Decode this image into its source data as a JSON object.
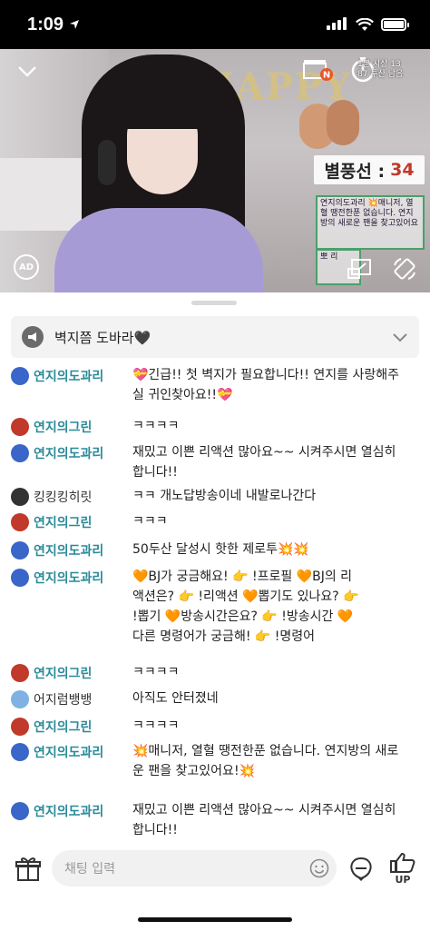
{
  "status": {
    "time": "1:09"
  },
  "video": {
    "balloon_label": "별풍선 :",
    "balloon_count": "34",
    "overlay_chat_text": "연지의도과리 💥매니저, 열혈 땡전한푼 없습니다. 연지방의 새로운 팬을 찾고있어요",
    "overlay_chat2_text": "뽀 리",
    "settings_line1": "1분 시상 13",
    "settings_line2": "87 투산 남음",
    "ad_label": "AD",
    "rec_badge": "N"
  },
  "notice": {
    "text": "벽지쯤 도바라🖤"
  },
  "messages": [
    {
      "nick": "연지의도과리",
      "avatar": "#3a65c9",
      "text": "💝긴급!! 첫 벽지가 필요합니다!! 연지를 사랑해주실 귀인찾아요!!💝",
      "bold": true
    },
    {
      "nick": "연지의그린",
      "avatar": "#c0392b",
      "text": "ㅋㅋㅋㅋ",
      "bold": true
    },
    {
      "nick": "연지의도과리",
      "avatar": "#3a65c9",
      "text": "재밌고 이쁜 리액션 많아요~~ 시켜주시면 열심히 합니다!!",
      "bold": true
    },
    {
      "nick": "킹킹킹히릿",
      "avatar": "#333333",
      "text": "ㅋㅋ 개노답방송이네 내발로나간다",
      "bold": false
    },
    {
      "nick": "연지의그린",
      "avatar": "#c0392b",
      "text": "ㅋㅋㅋ",
      "bold": true
    },
    {
      "nick": "연지의도과리",
      "avatar": "#3a65c9",
      "text": "50두산 달성시 핫한 제로투💥💥",
      "bold": true
    },
    {
      "nick": "연지의도과리",
      "avatar": "#3a65c9",
      "text": "🧡BJ가 궁금해요! 👉 !프로필 🧡BJ의 리액션은? 👉 !리액션 🧡뽑기도 있나요? 👉 !뽑기 🧡방송시간은요? 👉 !방송시간 🧡다른 명령어가 궁금해! 👉 !명령어",
      "bold": true
    },
    {
      "nick": "연지의그린",
      "avatar": "#c0392b",
      "text": "ㅋㅋㅋㅋ",
      "bold": true
    },
    {
      "nick": "어지럼뱅뱅",
      "avatar": "#7fb1e3",
      "text": "아직도 안터졌네",
      "bold": false
    },
    {
      "nick": "연지의그린",
      "avatar": "#c0392b",
      "text": "ㅋㅋㅋㅋ",
      "bold": true
    },
    {
      "nick": "연지의도과리",
      "avatar": "#3a65c9",
      "text": "💥매니저, 열혈 땡전한푼 없습니다. 연지방의 새로운 팬을 찾고있어요!💥",
      "bold": true
    },
    {
      "nick": "연지의도과리",
      "avatar": "#3a65c9",
      "text": "재밌고 이쁜 리액션 많아요~~ 시켜주시면 열심히 합니다!!",
      "bold": true
    }
  ],
  "input": {
    "placeholder": "채팅 입력",
    "up_label": "UP"
  }
}
